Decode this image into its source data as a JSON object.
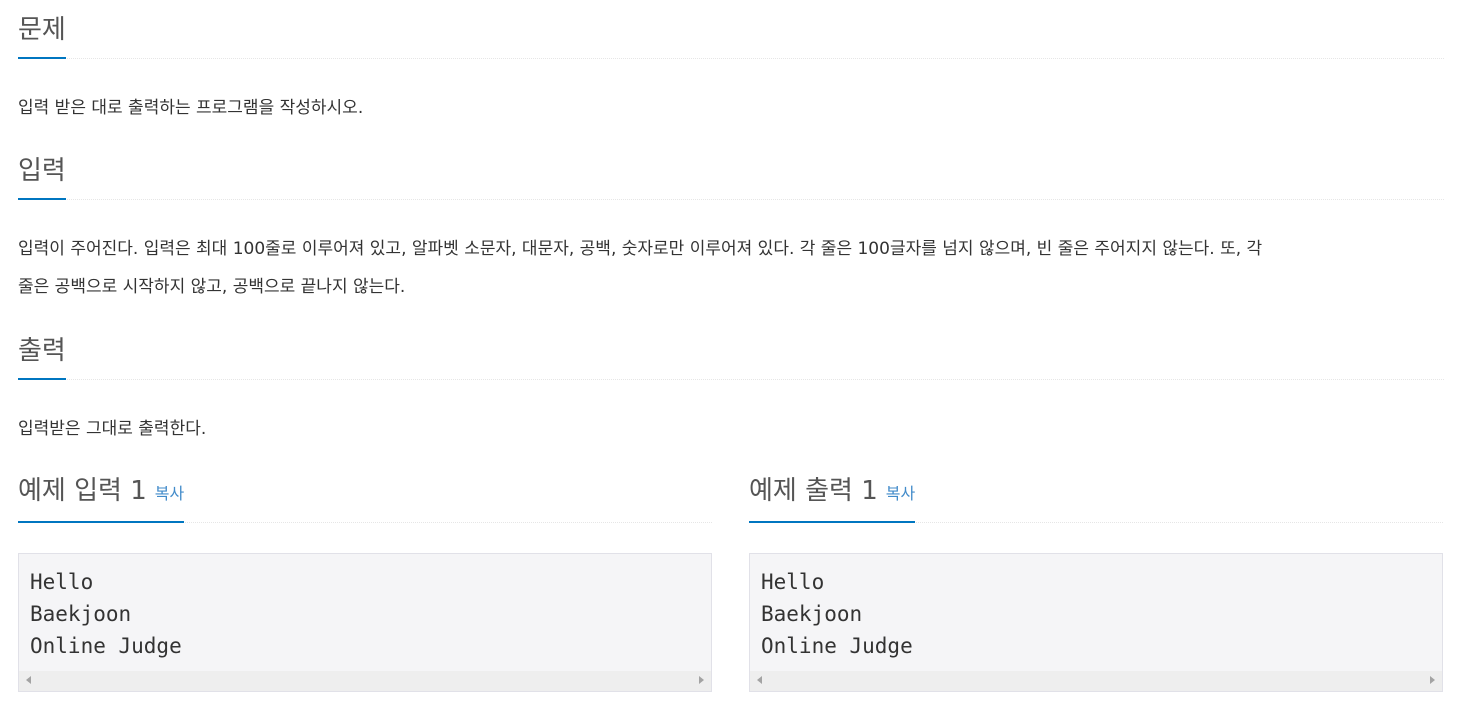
{
  "problem": {
    "title": "문제",
    "description": "입력 받은 대로 출력하는 프로그램을 작성하시오."
  },
  "input": {
    "title": "입력",
    "description_line1": "입력이 주어진다. 입력은 최대 100줄로 이루어져 있고, 알파벳 소문자, 대문자, 공백, 숫자로만 이루어져 있다. 각 줄은 100글자를 넘지 않으며, 빈 줄은 주어지지 않는다. 또, 각",
    "description_line2": "줄은 공백으로 시작하지 않고, 공백으로 끝나지 않는다."
  },
  "output": {
    "title": "출력",
    "description": "입력받은 그대로 출력한다."
  },
  "sample_input": {
    "title": "예제 입력 1",
    "copy_label": "복사",
    "content": "Hello\nBaekjoon\nOnline Judge"
  },
  "sample_output": {
    "title": "예제 출력 1",
    "copy_label": "복사",
    "content": "Hello\nBaekjoon\nOnline Judge"
  },
  "colors": {
    "accent": "#0076c0",
    "link": "#428bca",
    "code_bg": "#f5f5f7"
  }
}
